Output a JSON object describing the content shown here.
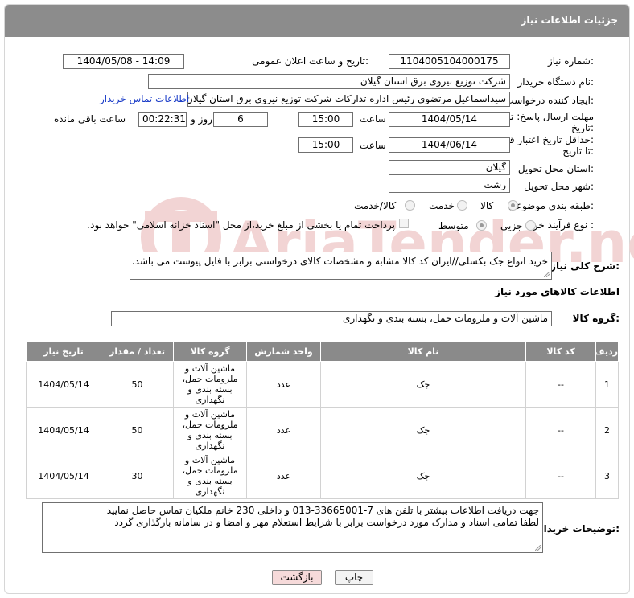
{
  "header": {
    "title": "جزئیات اطلاعات نیاز"
  },
  "form": {
    "need_number": {
      "label": "شماره نیاز:",
      "value": "1104005104000175"
    },
    "announce_datetime": {
      "label": "تاریخ و ساعت اعلان عمومی:",
      "value": "1404/05/08 - 14:09"
    },
    "buyer_org": {
      "label": "نام دستگاه خریدار:",
      "value": "شرکت توزیع نیروی برق استان گیلان"
    },
    "requester": {
      "label": "ایجاد کننده درخواست:",
      "value": "سیداسماعیل مرتضوی رئیس اداره تدارکات شرکت توزیع نیروی برق استان گیلان",
      "contact_link": "اطلاعات تماس خریدار"
    },
    "reply_deadline": {
      "label_line1": "مهلت ارسال پاسخ: تا",
      "label_line2": "تاریخ:",
      "date": "1404/05/14",
      "time_label": "ساعت",
      "time": "15:00",
      "days": "6",
      "days_label": "روز و",
      "remaining": "00:22:31",
      "remaining_label": "ساعت باقی مانده"
    },
    "price_validity": {
      "label_line1": "حداقل تاریخ اعتبار قیمت:",
      "label_line2": "تا تاریخ:",
      "date": "1404/06/14",
      "time_label": "ساعت",
      "time": "15:00"
    },
    "province": {
      "label": "استان محل تحویل:",
      "value": "گیلان"
    },
    "city": {
      "label": "شهر محل تحویل:",
      "value": "رشت"
    },
    "category": {
      "label": "طبقه بندی موضوعی:",
      "options": [
        "کالا",
        "خدمت",
        "کالا/خدمت"
      ],
      "selected": 0
    },
    "process": {
      "label": "نوع فرآیند خرید :",
      "options": [
        "جزیی",
        "متوسط"
      ],
      "selected": 1,
      "checkbox_text": "پرداخت تمام یا بخشی از مبلغ خرید،از محل \"اسناد خزانه اسلامی\" خواهد بود."
    },
    "description": {
      "label": "شرح کلی نیاز:",
      "value": "خرید انواع جک بکسلی//ایران کد کالا مشابه و مشخصات کالای درخواستی برابر با فایل پیوست می باشد."
    }
  },
  "goods": {
    "title": "اطلاعات کالاهای مورد نیاز",
    "group_label": "گروه کالا:",
    "group_value": "ماشین آلات و ملزومات حمل، بسته بندی و نگهداری",
    "columns": [
      "ردیف",
      "کد کالا",
      "نام کالا",
      "واحد شمارش",
      "گروه کالا",
      "تعداد / مقدار",
      "تاریخ نیاز"
    ],
    "rows": [
      {
        "row": "1",
        "code": "--",
        "name": "جک",
        "unit": "عدد",
        "group": "ماشین آلات و ملزومات حمل، بسته بندی و نگهداری",
        "qty": "50",
        "date": "1404/05/14"
      },
      {
        "row": "2",
        "code": "--",
        "name": "جک",
        "unit": "عدد",
        "group": "ماشین آلات و ملزومات حمل، بسته بندی و نگهداری",
        "qty": "50",
        "date": "1404/05/14"
      },
      {
        "row": "3",
        "code": "--",
        "name": "جک",
        "unit": "عدد",
        "group": "ماشین آلات و ملزومات حمل، بسته بندی و نگهداری",
        "qty": "30",
        "date": "1404/05/14"
      }
    ]
  },
  "buyer_notes": {
    "label": "توضیحات خریدار:",
    "line1": "جهت دریافت اطلاعات بیشتر با تلفن های 7-33665001-013 و داخلی 230 خانم ملکیان تماس حاصل نمایید",
    "line2": "لطفا تمامی اسناد و مدارک مورد درخواست برابر با شرایط استعلام مهر و امضا و در سامانه بارگذاری گردد"
  },
  "buttons": {
    "print": "چاپ",
    "back": "بازگشت"
  },
  "watermark": "AriaTender.net",
  "colors": {
    "header_bg": "#8c8c8c",
    "link": "#1a3cc8",
    "back_button_bg": "#f6dada",
    "watermark": "#f2d4d4"
  }
}
